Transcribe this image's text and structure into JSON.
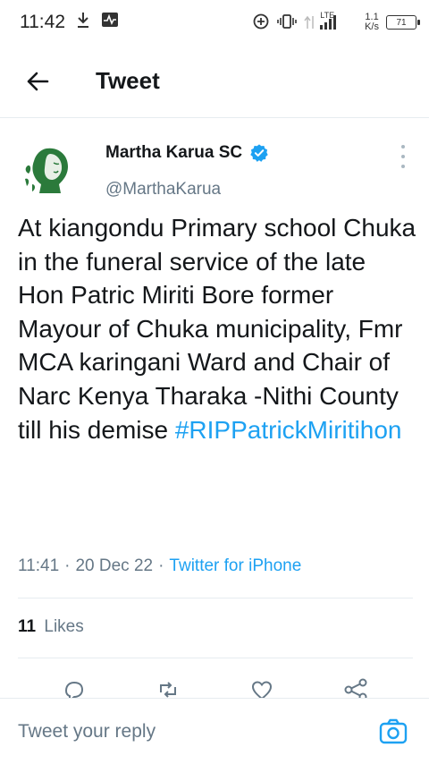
{
  "status_bar": {
    "time": "11:42",
    "network_type": "LTE",
    "speed_value": "1.1",
    "speed_unit": "K/s",
    "battery": "71",
    "icons": [
      "download-icon",
      "activity-icon",
      "data-saver-icon",
      "vibrate-icon",
      "signal-icon",
      "battery-icon"
    ]
  },
  "app_bar": {
    "title": "Tweet",
    "back_icon": "arrow-left-icon"
  },
  "tweet": {
    "author_name": "Martha Karua SC",
    "author_handle": "@MarthaKarua",
    "verified": true,
    "text": "At kiangondu Primary school Chuka in the funeral service of the late Hon Patric Miriti Bore former Mayour of Chuka municipality, Fmr MCA karingani Ward and Chair of Narc Kenya Tharaka -Nithi County till his demise",
    "hashtag": "#RIPPatrickMiritihon",
    "time": "11:41",
    "date": "20 Dec 22",
    "client": "Twitter for iPhone",
    "separator": "·",
    "likes_count": "11",
    "likes_label": "Likes"
  },
  "reply": {
    "placeholder": "Tweet your reply"
  },
  "colors": {
    "accent": "#1da1f2",
    "text_primary": "#14171a",
    "text_secondary": "#657786",
    "divider": "#e6ecf0"
  }
}
